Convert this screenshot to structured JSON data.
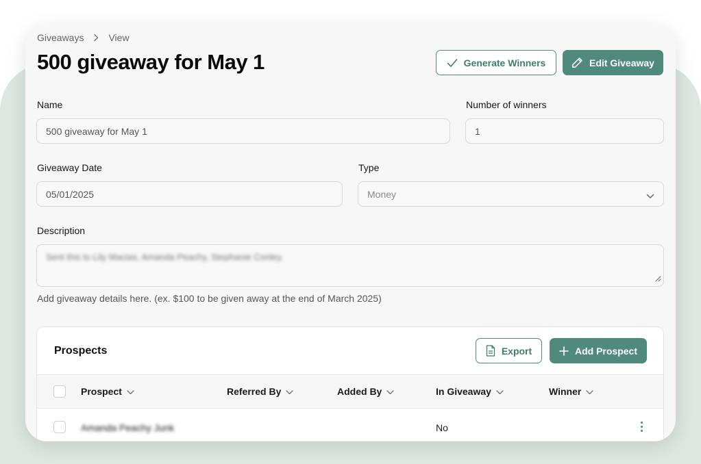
{
  "breadcrumb": {
    "items": [
      "Giveaways",
      "View"
    ]
  },
  "page": {
    "title": "500 giveaway for May 1"
  },
  "actions": {
    "generate_winners": "Generate Winners",
    "edit_giveaway": "Edit Giveaway"
  },
  "form": {
    "name": {
      "label": "Name",
      "value": "500 giveaway for May 1"
    },
    "winners": {
      "label": "Number of winners",
      "value": "1"
    },
    "date": {
      "label": "Giveaway Date",
      "value": "05/01/2025"
    },
    "type": {
      "label": "Type",
      "value": "Money"
    },
    "description": {
      "label": "Description",
      "value": "Sent this to Lily Macias, Amanda Peachy, Stephanie Conley.",
      "helper": "Add giveaway details here. (ex. $100 to be given away at the end of March 2025)"
    }
  },
  "prospects": {
    "title": "Prospects",
    "export_label": "Export",
    "add_label": "Add Prospect",
    "columns": [
      "Prospect",
      "Referred By",
      "Added By",
      "In Giveaway",
      "Winner"
    ],
    "rows": [
      {
        "prospect": "Amanda Peachy Junk",
        "referred_by": "",
        "added_by": "",
        "in_giveaway": "No",
        "winner": ""
      }
    ]
  },
  "colors": {
    "accent": "#4f8a7c",
    "background_blob": "#dde7e1",
    "card": "#f7f7f7"
  }
}
